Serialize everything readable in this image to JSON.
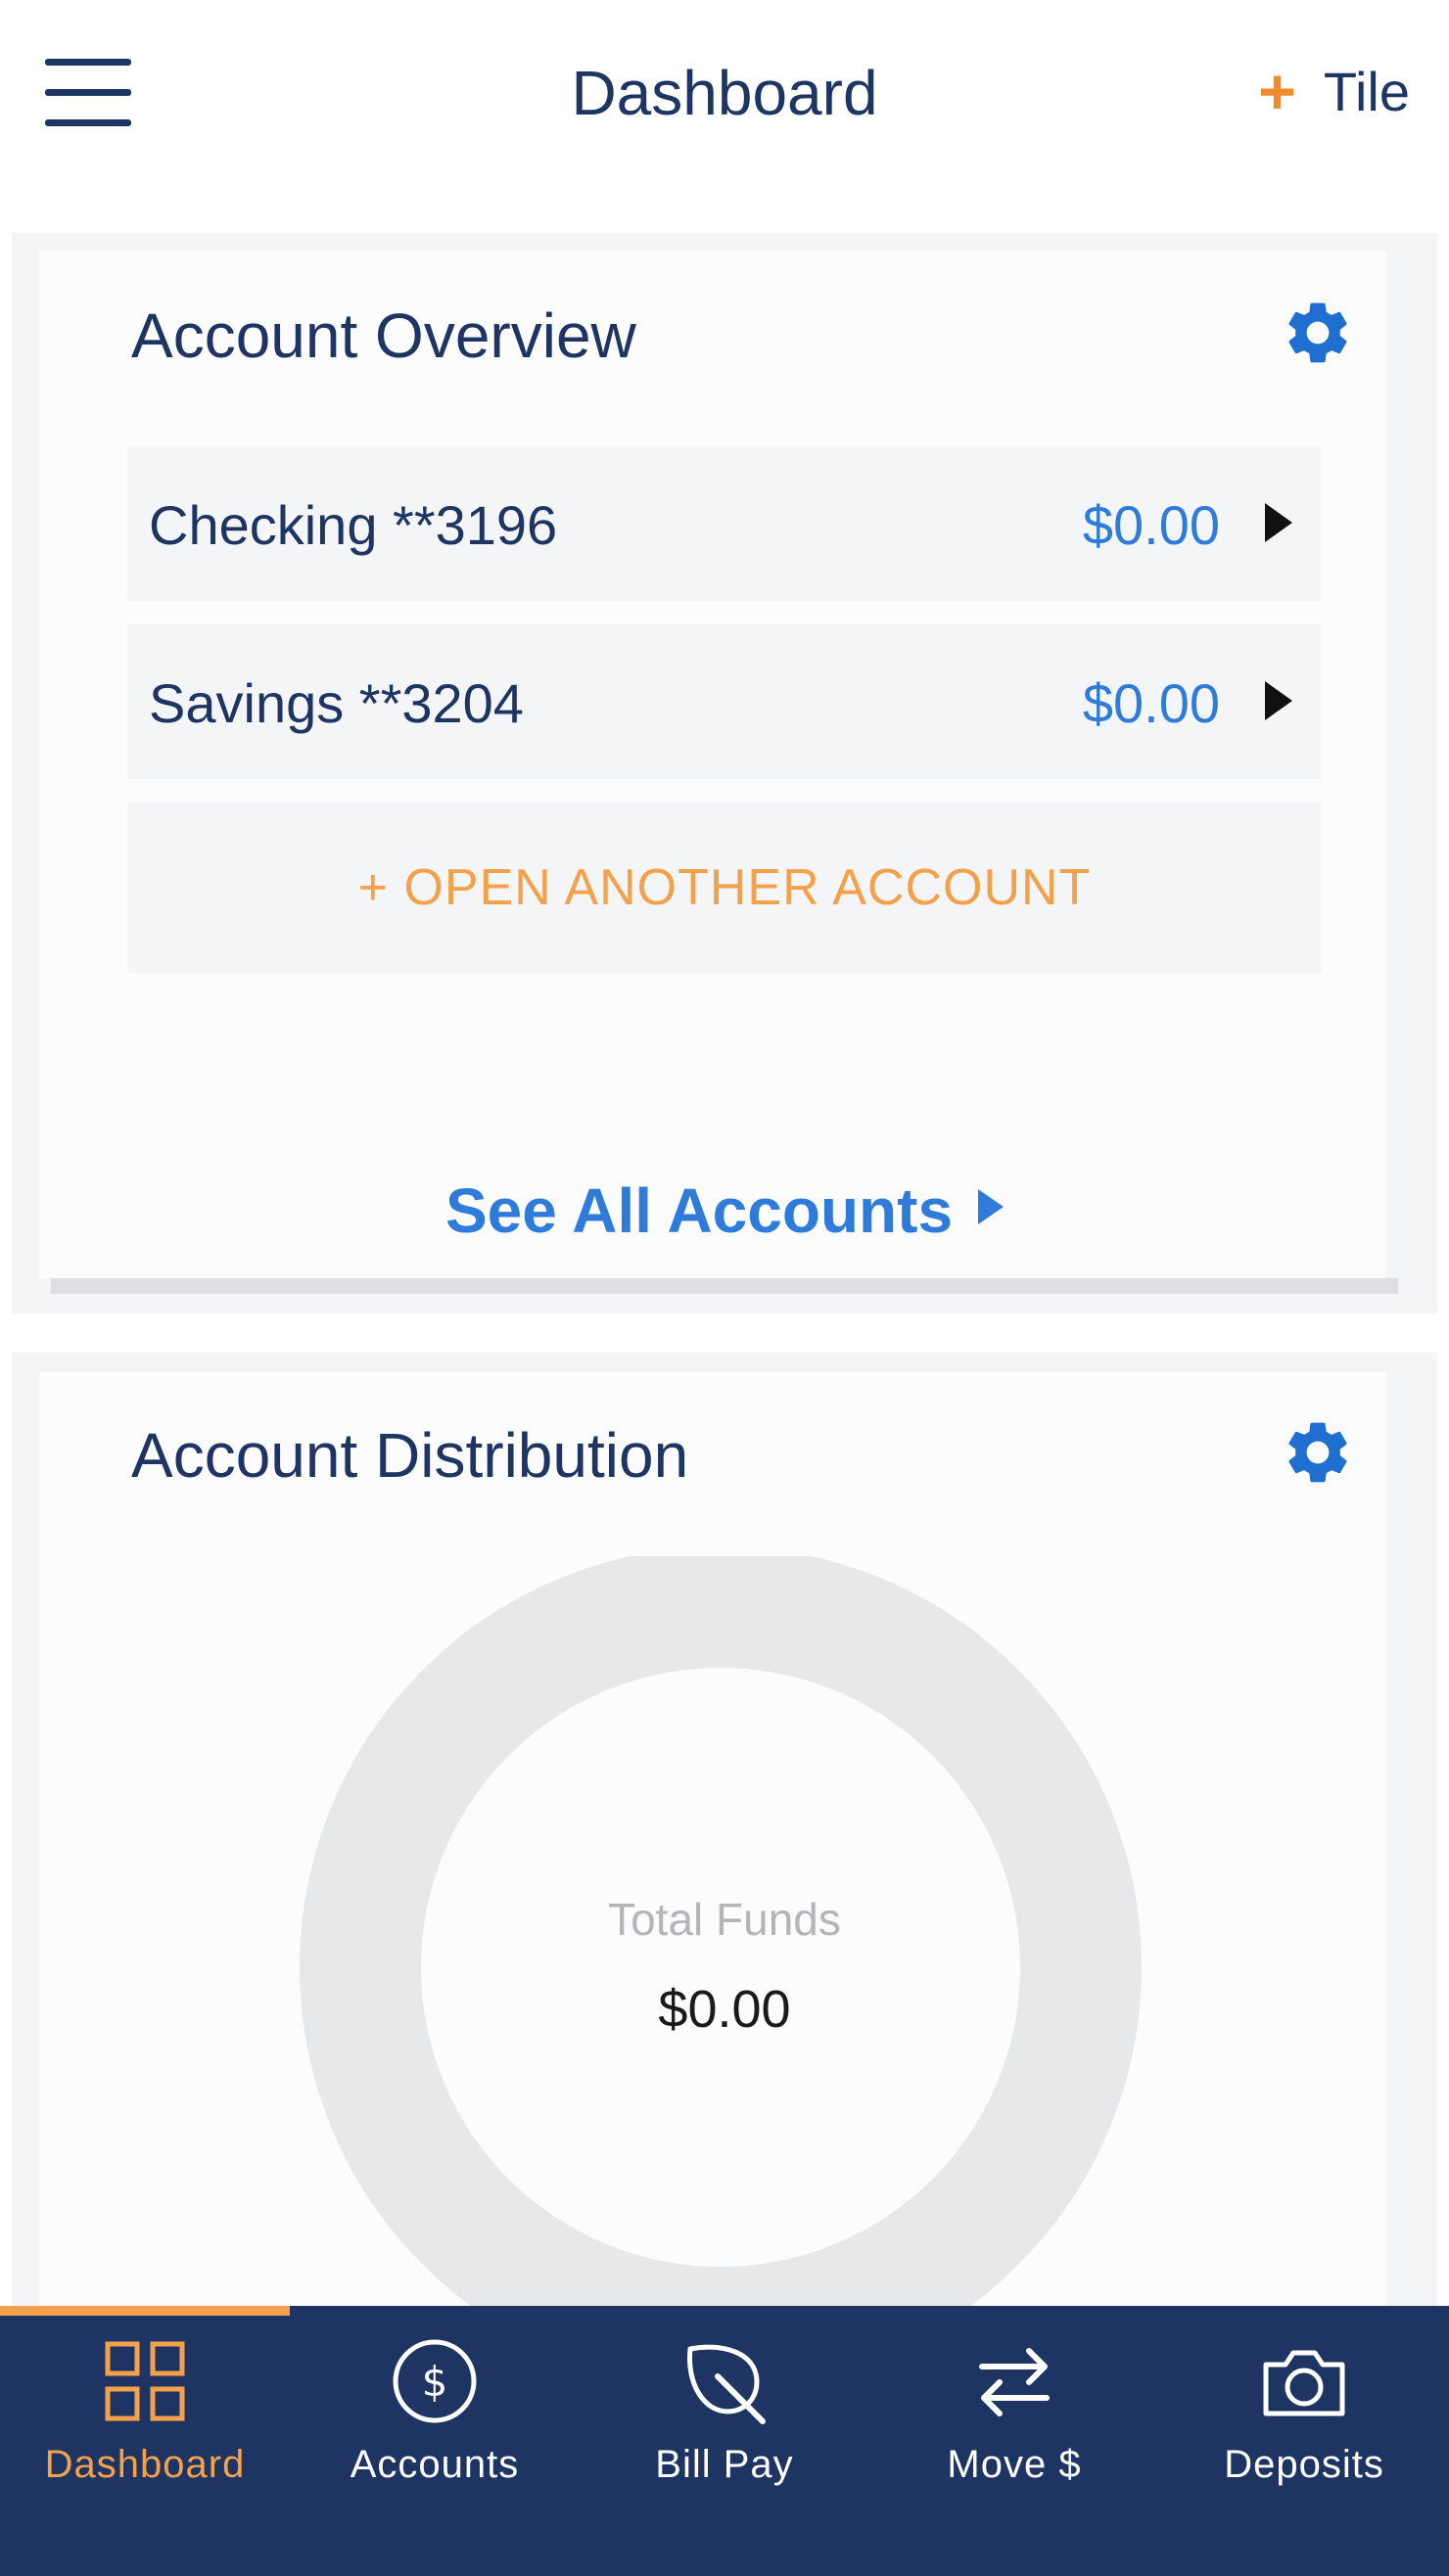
{
  "header": {
    "title": "Dashboard",
    "add_tile_plus": "+",
    "add_tile_label": "Tile"
  },
  "overview": {
    "title": "Account Overview",
    "accounts": [
      {
        "name": "Checking **3196",
        "balance": "$0.00"
      },
      {
        "name": "Savings **3204",
        "balance": "$0.00"
      }
    ],
    "open_account_label": "+ OPEN ANOTHER ACCOUNT",
    "see_all_label": "See All Accounts"
  },
  "distribution": {
    "title": "Account Distribution",
    "center_label": "Total Funds",
    "center_value": "$0.00"
  },
  "nav": {
    "items": [
      {
        "label": "Dashboard",
        "icon": "grid-icon",
        "active": true
      },
      {
        "label": "Accounts",
        "icon": "dollar-circle-icon",
        "active": false
      },
      {
        "label": "Bill Pay",
        "icon": "leaf-icon",
        "active": false
      },
      {
        "label": "Move $",
        "icon": "transfer-arrows-icon",
        "active": false
      },
      {
        "label": "Deposits",
        "icon": "camera-icon",
        "active": false
      }
    ]
  },
  "colors": {
    "navy": "#1e3563",
    "accent_orange": "#f4a14c",
    "link_blue": "#2f7bd9",
    "tile_bg": "#f4f5f7",
    "donut_ring": "#e7e8ea"
  }
}
